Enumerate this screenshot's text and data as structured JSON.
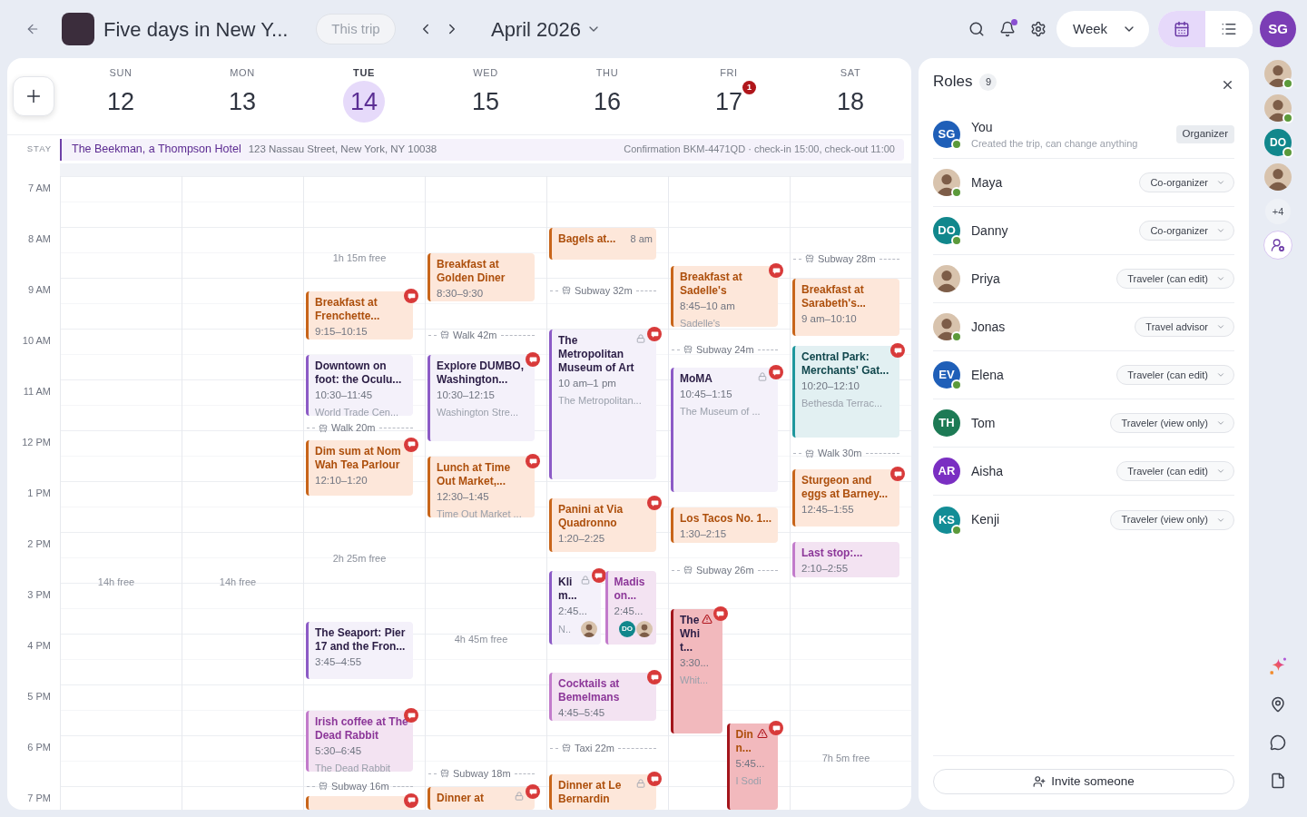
{
  "top_bar": {
    "title": "Five days in New Y...",
    "scope_button": "This trip",
    "month": "April 2026",
    "notifications": {
      "unread": true
    },
    "view_select": "Week",
    "view_modes": [
      {
        "kind": "calendar",
        "selected": true
      },
      {
        "kind": "list",
        "selected": false
      }
    ],
    "user": {
      "initials": "SG"
    }
  },
  "calendar": {
    "days": [
      {
        "name": "SUN",
        "number": "12",
        "selected": false,
        "items": [
          {
            "kind": "free",
            "label": "14h free"
          }
        ]
      },
      {
        "name": "MON",
        "number": "13",
        "selected": false,
        "items": [
          {
            "kind": "free",
            "label": "14h free"
          }
        ]
      },
      {
        "name": "TUE",
        "number": "14",
        "selected": true,
        "items": [
          {
            "kind": "free",
            "label": "1h 15m free"
          },
          {
            "kind": "food",
            "title": "Breakfast at Frenchette...",
            "time": "9:15–10:15",
            "locked": false,
            "conflict": false,
            "comment": true
          },
          {
            "kind": "sight",
            "title": "Downtown on foot: the Oculu...",
            "time": "10:30–11:45",
            "place": "World Trade Cen...",
            "locked": false,
            "conflict": false,
            "comment": false
          },
          {
            "kind": "travel",
            "label": "Walk 20m"
          },
          {
            "kind": "food",
            "title": "Dim sum at Nom Wah Tea Parlour",
            "time": "12:10–1:20",
            "locked": false,
            "conflict": false,
            "comment": true
          },
          {
            "kind": "free",
            "label": "2h 25m free"
          },
          {
            "kind": "sight",
            "title": "The Seaport: Pier 17 and the Fron...",
            "time": "3:45–4:55",
            "locked": false,
            "conflict": false,
            "comment": false
          },
          {
            "kind": "drinks",
            "title": "Irish coffee at The Dead Rabbit",
            "time": "5:30–6:45",
            "place": "The Dead Rabbit",
            "locked": false,
            "conflict": false,
            "comment": true
          },
          {
            "kind": "travel",
            "label": "Subway 16m"
          },
          {
            "kind": "food",
            "locked": false,
            "conflict": false,
            "comment": true
          }
        ]
      },
      {
        "name": "WED",
        "number": "15",
        "selected": false,
        "items": [
          {
            "kind": "food",
            "title": "Breakfast at Golden Diner",
            "time": "8:30–9:30",
            "locked": false,
            "conflict": false,
            "comment": false
          },
          {
            "kind": "travel",
            "label": "Walk 42m"
          },
          {
            "kind": "sight",
            "title": "Explore DUMBO, Washington...",
            "time": "10:30–12:15",
            "place": "Washington Stre...",
            "locked": false,
            "conflict": false,
            "comment": true
          },
          {
            "kind": "food",
            "title": "Lunch at Time Out Market,...",
            "time": "12:30–1:45",
            "place": "Time Out Market ...",
            "locked": false,
            "conflict": false,
            "comment": true
          },
          {
            "kind": "free",
            "label": "4h 45m free"
          },
          {
            "kind": "travel",
            "label": "Subway 18m"
          },
          {
            "kind": "food",
            "title": "Dinner at",
            "locked": true,
            "conflict": false,
            "comment": true
          }
        ]
      },
      {
        "name": "THU",
        "number": "16",
        "selected": false,
        "items": [
          {
            "kind": "food",
            "title": "Bagels at...",
            "time": "8 am",
            "locked": false,
            "conflict": false,
            "comment": false
          },
          {
            "kind": "travel",
            "label": "Subway 32m"
          },
          {
            "kind": "sight",
            "title": "The Metropolitan Museum of Art",
            "time": "10 am–1 pm",
            "place": "The Metropolitan...",
            "locked": true,
            "conflict": false,
            "comment": true
          },
          {
            "kind": "food",
            "title": "Panini at Via Quadronno",
            "time": "1:20–2:25",
            "locked": false,
            "conflict": false,
            "comment": true
          },
          {
            "kind": "sight",
            "title": "Kli m...",
            "time": "2:45...",
            "place": "N..",
            "locked": true,
            "conflict": false,
            "comment": true,
            "people": [
              {
                "kind": "photo"
              }
            ]
          },
          {
            "kind": "drinks",
            "title": "Madis on...",
            "time": "2:45...",
            "locked": false,
            "conflict": false,
            "comment": false,
            "people": [
              {
                "kind": "initials",
                "initials": "DO",
                "color": "#11878c"
              },
              {
                "kind": "photo"
              }
            ]
          },
          {
            "kind": "drinks",
            "title": "Cocktails at Bemelmans",
            "time": "4:45–5:45",
            "locked": false,
            "conflict": false,
            "comment": true
          },
          {
            "kind": "travel",
            "label": "Taxi 22m"
          },
          {
            "kind": "food",
            "title": "Dinner at Le Bernardin",
            "locked": true,
            "conflict": false,
            "comment": true
          }
        ]
      },
      {
        "name": "FRI",
        "number": "17",
        "selected": false,
        "badge": "1",
        "items": [
          {
            "kind": "food",
            "title": "Breakfast at Sadelle's",
            "time": "8:45–10 am",
            "place": "Sadelle's",
            "locked": false,
            "conflict": false,
            "comment": true
          },
          {
            "kind": "travel",
            "label": "Subway 24m"
          },
          {
            "kind": "sight",
            "title": "MoMA",
            "time": "10:45–1:15",
            "place": "The Museum of ...",
            "locked": true,
            "conflict": false,
            "comment": true
          },
          {
            "kind": "food",
            "title": "Los Tacos No. 1...",
            "time": "1:30–2:15",
            "locked": false,
            "conflict": false,
            "comment": false
          },
          {
            "kind": "travel",
            "label": "Subway 26m"
          },
          {
            "kind": "sight",
            "title": "The Whi t...",
            "time": "3:30...",
            "place": "Whit...",
            "locked": false,
            "conflict": true,
            "comment": true
          },
          {
            "kind": "food",
            "title": "Din n...",
            "time": "5:45...",
            "place": "I Sodi",
            "locked": false,
            "conflict": true,
            "comment": true
          }
        ]
      },
      {
        "name": "SAT",
        "number": "18",
        "selected": false,
        "items": [
          {
            "kind": "travel",
            "label": "Subway 28m"
          },
          {
            "kind": "food",
            "title": "Breakfast at Sarabeth's...",
            "time": "9 am–10:10",
            "locked": false,
            "conflict": false,
            "comment": false
          },
          {
            "kind": "park",
            "title": "Central Park: Merchants' Gat...",
            "time": "10:20–12:10",
            "place": "Bethesda Terrac...",
            "locked": false,
            "conflict": false,
            "comment": true
          },
          {
            "kind": "travel",
            "label": "Walk 30m"
          },
          {
            "kind": "food",
            "title": "Sturgeon and eggs at Barney...",
            "time": "12:45–1:55",
            "locked": false,
            "conflict": false,
            "comment": true
          },
          {
            "kind": "drinks",
            "title": "Last stop:...",
            "time": "2:10–2:55",
            "locked": false,
            "conflict": false,
            "comment": false
          },
          {
            "kind": "free",
            "label": "7h 5m free"
          }
        ]
      }
    ],
    "stay": {
      "label": "STAY",
      "name": "The Beekman, a Thompson Hotel",
      "address": "123 Nassau Street, New York, NY 10038",
      "details": "Confirmation BKM-4471QD · check-in 15:00, check-out 11:00"
    },
    "hours": [
      "7 AM",
      "8 AM",
      "9 AM",
      "10 AM",
      "11 AM",
      "12 PM",
      "1 PM",
      "2 PM",
      "3 PM",
      "4 PM",
      "5 PM",
      "6 PM",
      "7 PM"
    ]
  },
  "roles": {
    "title": "Roles",
    "count": "9",
    "members": [
      {
        "name": "You",
        "avatar": {
          "kind": "initials",
          "initials": "SG",
          "color": "#1f5fb8"
        },
        "online": true,
        "note": "Created the trip, can change anything",
        "role": {
          "kind": "tag",
          "label": "Organizer"
        }
      },
      {
        "name": "Maya",
        "avatar": {
          "kind": "photo"
        },
        "online": true,
        "role": {
          "kind": "dropdown",
          "label": "Co-organizer"
        }
      },
      {
        "name": "Danny",
        "avatar": {
          "kind": "initials",
          "initials": "DO",
          "color": "#11878c"
        },
        "online": true,
        "role": {
          "kind": "dropdown",
          "label": "Co-organizer"
        }
      },
      {
        "name": "Priya",
        "avatar": {
          "kind": "photo"
        },
        "online": false,
        "role": {
          "kind": "dropdown",
          "label": "Traveler (can edit)"
        }
      },
      {
        "name": "Jonas",
        "avatar": {
          "kind": "photo"
        },
        "online": true,
        "role": {
          "kind": "dropdown",
          "label": "Travel advisor"
        }
      },
      {
        "name": "Elena",
        "avatar": {
          "kind": "initials",
          "initials": "EV",
          "color": "#1f5fb8"
        },
        "online": true,
        "role": {
          "kind": "dropdown",
          "label": "Traveler (can edit)"
        }
      },
      {
        "name": "Tom",
        "avatar": {
          "kind": "initials",
          "initials": "TH",
          "color": "#1d7a55"
        },
        "online": false,
        "role": {
          "kind": "dropdown",
          "label": "Traveler (view only)"
        }
      },
      {
        "name": "Aisha",
        "avatar": {
          "kind": "initials",
          "initials": "AR",
          "color": "#7a2fc2"
        },
        "online": false,
        "role": {
          "kind": "dropdown",
          "label": "Traveler (can edit)"
        }
      },
      {
        "name": "Kenji",
        "avatar": {
          "kind": "initials",
          "initials": "KS",
          "color": "#138d96"
        },
        "online": true,
        "role": {
          "kind": "dropdown",
          "label": "Traveler (view only)"
        }
      }
    ],
    "invite_button": "Invite someone"
  },
  "rail": {
    "people": [
      {
        "avatar": {
          "kind": "photo"
        },
        "online": true
      },
      {
        "avatar": {
          "kind": "photo"
        },
        "online": true
      },
      {
        "avatar": {
          "kind": "initials",
          "initials": "DO",
          "color": "#11878c"
        },
        "online": true
      },
      {
        "avatar": {
          "kind": "photo"
        },
        "online": false
      }
    ],
    "more": "+4"
  }
}
